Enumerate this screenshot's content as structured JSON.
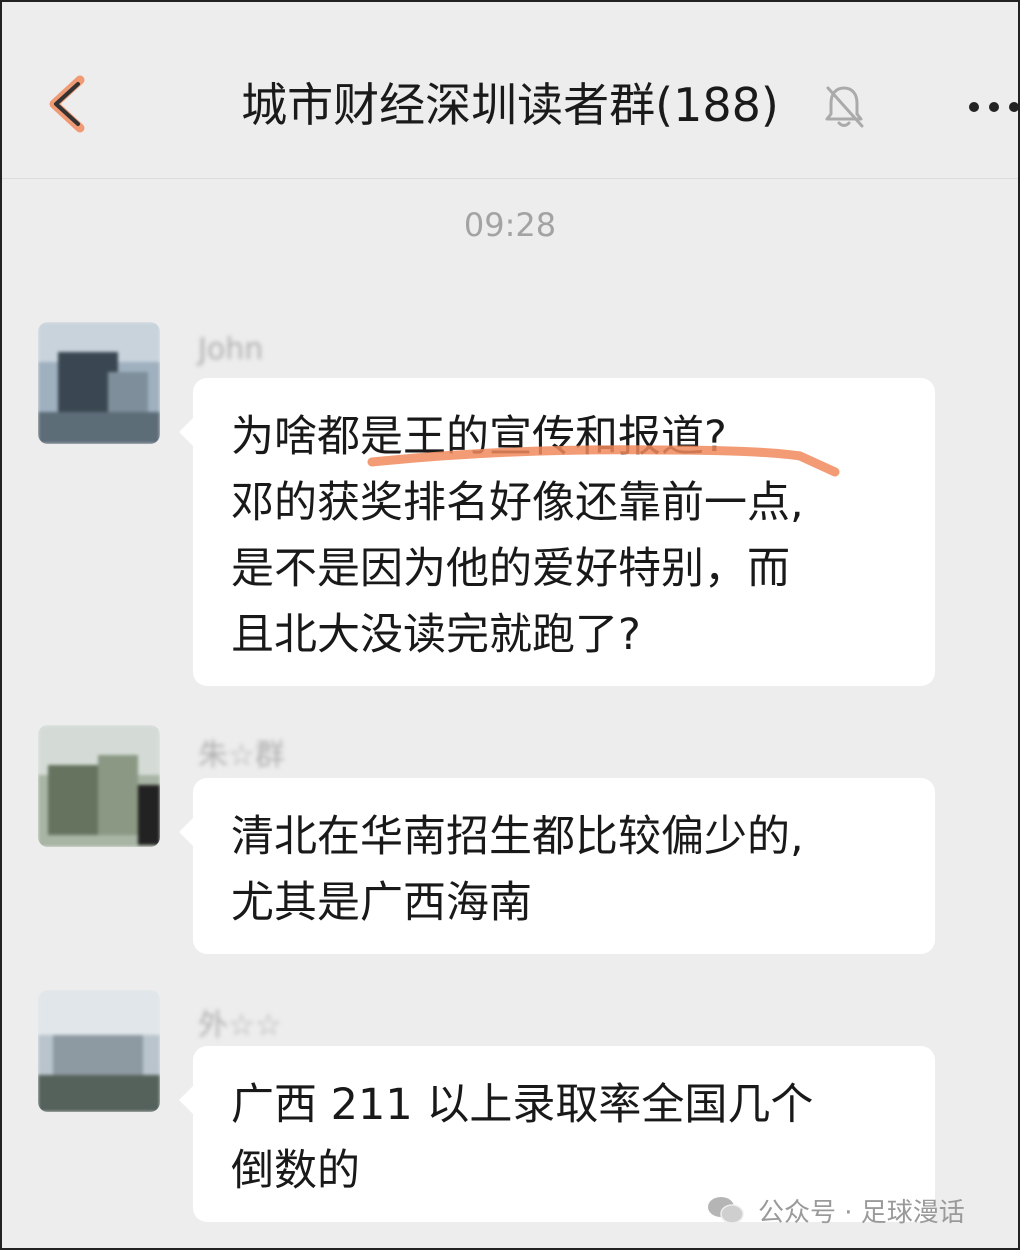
{
  "header": {
    "title": "城市财经深圳读者群(188)",
    "back_icon": "chevron-left-icon",
    "mute_icon": "bell-off-icon",
    "more_icon": "more-dots-icon"
  },
  "chat": {
    "timestamp": "09:28",
    "messages": [
      {
        "sender": "John",
        "lines": [
          "为啥都是王的宣传和报道?",
          "邓的获奖排名好像还靠前一点,",
          "是不是因为他的爱好特别，而",
          "且北大没读完就跑了?"
        ]
      },
      {
        "sender": "朱☆群",
        "lines": [
          "清北在华南招生都比较偏少的,",
          "尤其是广西海南"
        ]
      },
      {
        "sender": "外☆☆",
        "lines": [
          "广西 211 以上录取率全国几个",
          "倒数的"
        ]
      }
    ]
  },
  "watermark": {
    "text": "公众号 · 足球漫话"
  },
  "colors": {
    "background": "#ededed",
    "bubble": "#ffffff",
    "highlight_stroke": "#f08a5d"
  }
}
